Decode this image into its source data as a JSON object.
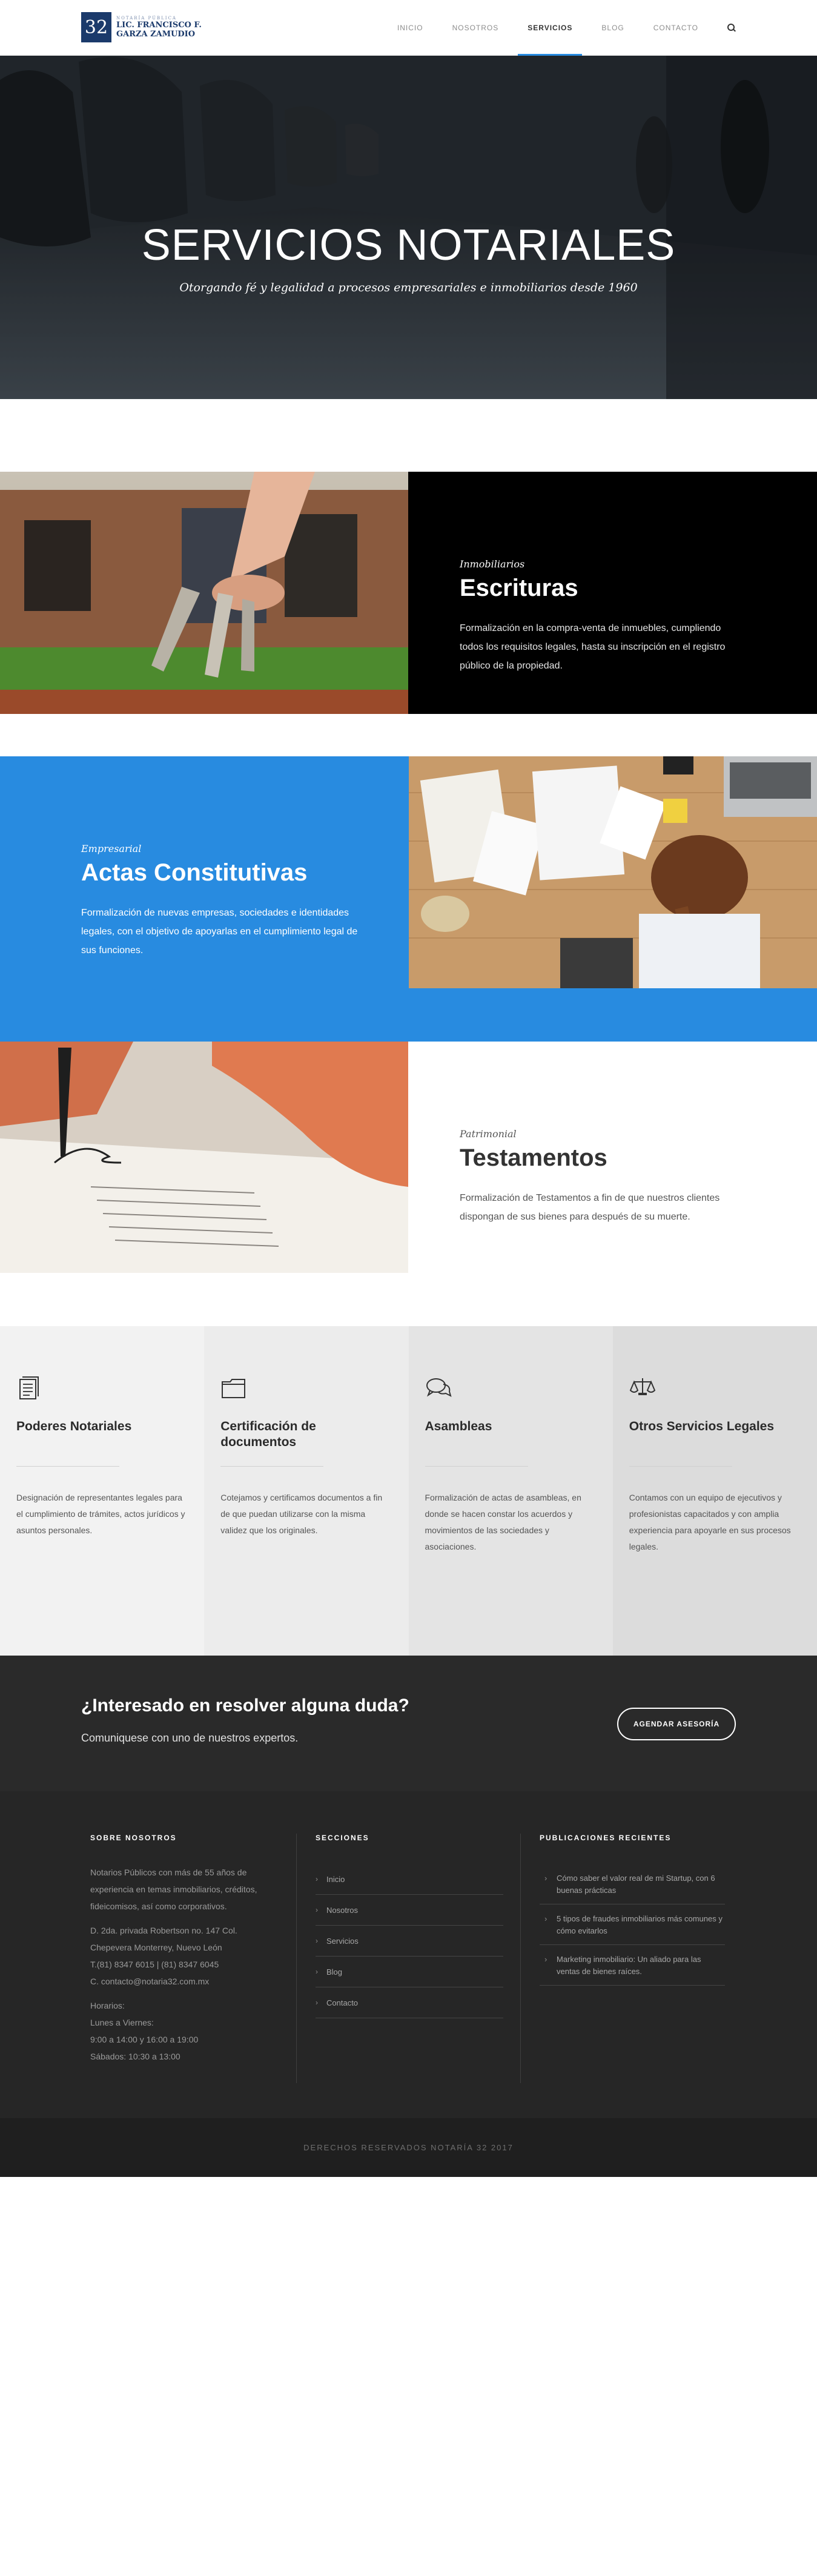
{
  "header": {
    "logo_number": "32",
    "logo_sub": "NOTARÍA PÚBLICA",
    "logo_line1": "LIC. FRANCISCO F.",
    "logo_line2": "GARZA ZAMUDIO",
    "nav": [
      "INICIO",
      "NOSOTROS",
      "SERVICIOS",
      "BLOG",
      "CONTACTO"
    ],
    "active_nav": "SERVICIOS",
    "accent": "#288be0"
  },
  "hero": {
    "title": "SERVICIOS NOTARIALES",
    "subtitle": "Otorgando fé y legalidad a procesos empresariales e inmobiliarios desde 1960"
  },
  "features": [
    {
      "eyebrow": "Inmobiliarios",
      "title": "Escrituras",
      "body": "Formalización en la compra-venta de inmuebles, cumpliendo todos los requisitos legales, hasta su inscripción en el registro público de la propiedad."
    },
    {
      "eyebrow": "Empresarial",
      "title": "Actas Constitutivas",
      "body": "Formalización de nuevas empresas, sociedades e identidades legales, con el objetivo de apoyarlas en el cumplimiento legal de sus funciones."
    },
    {
      "eyebrow": "Patrimonial",
      "title": "Testamentos",
      "body": "Formalización de Testamentos a fin de que nuestros clientes dispongan de sus bienes para después de su muerte."
    }
  ],
  "services": [
    {
      "icon": "document-icon",
      "title": "Poderes Notariales",
      "body": "Designación de representantes legales para el cumplimiento de trámites, actos jurídicos y asuntos personales."
    },
    {
      "icon": "folder-icon",
      "title": "Certificación de documentos",
      "body": "Cotejamos y certificamos documentos a fin de que puedan utilizarse con la misma validez que los originales."
    },
    {
      "icon": "chat-icon",
      "title": "Asambleas",
      "body": "Formalización de actas de asambleas, en donde se hacen constar los acuerdos y movimientos de las sociedades y asociaciones."
    },
    {
      "icon": "scales-icon",
      "title": "Otros Servicios Legales",
      "body": "Contamos con un equipo de ejecutivos y profesionistas capacitados y con amplia experiencia para apoyarle en sus procesos legales."
    }
  ],
  "cta": {
    "title": "¿Interesado en resolver alguna duda?",
    "subtitle": "Comuniquese con uno de nuestros expertos.",
    "button": "AGENDAR ASESORÍA"
  },
  "footer": {
    "about_title": "SOBRE NOSOTROS",
    "about_text": "Notarios Públicos con más de 55 años de experiencia en temas inmobiliarios, créditos, fideicomisos, así como corporativos.",
    "address1": "D. 2da. privada Robertson no. 147 Col.",
    "address2": "Chepevera Monterrey, Nuevo León",
    "phone": "T.(81) 8347 6015 | (81) 8347 6045",
    "email": "C. contacto@notaria32.com.mx",
    "hours_title": "Horarios:",
    "hours1": "Lunes a Viernes:",
    "hours2": "9:00 a 14:00 y 16:00 a 19:00",
    "hours3": "Sábados: 10:30 a 13:00",
    "sections_title": "SECCIONES",
    "sections": [
      "Inicio",
      "Nosotros",
      "Servicios",
      "Blog",
      "Contacto"
    ],
    "posts_title": "PUBLICACIONES RECIENTES",
    "posts": [
      "Cómo saber el valor real de mi Startup, con 6 buenas prácticas",
      "5 tipos de fraudes inmobiliarios más comunes y cómo evitarlos",
      "Marketing inmobiliario: Un aliado para las ventas de bienes raíces."
    ]
  },
  "copyright": "DERECHOS RESERVADOS NOTARÍA 32 2017"
}
